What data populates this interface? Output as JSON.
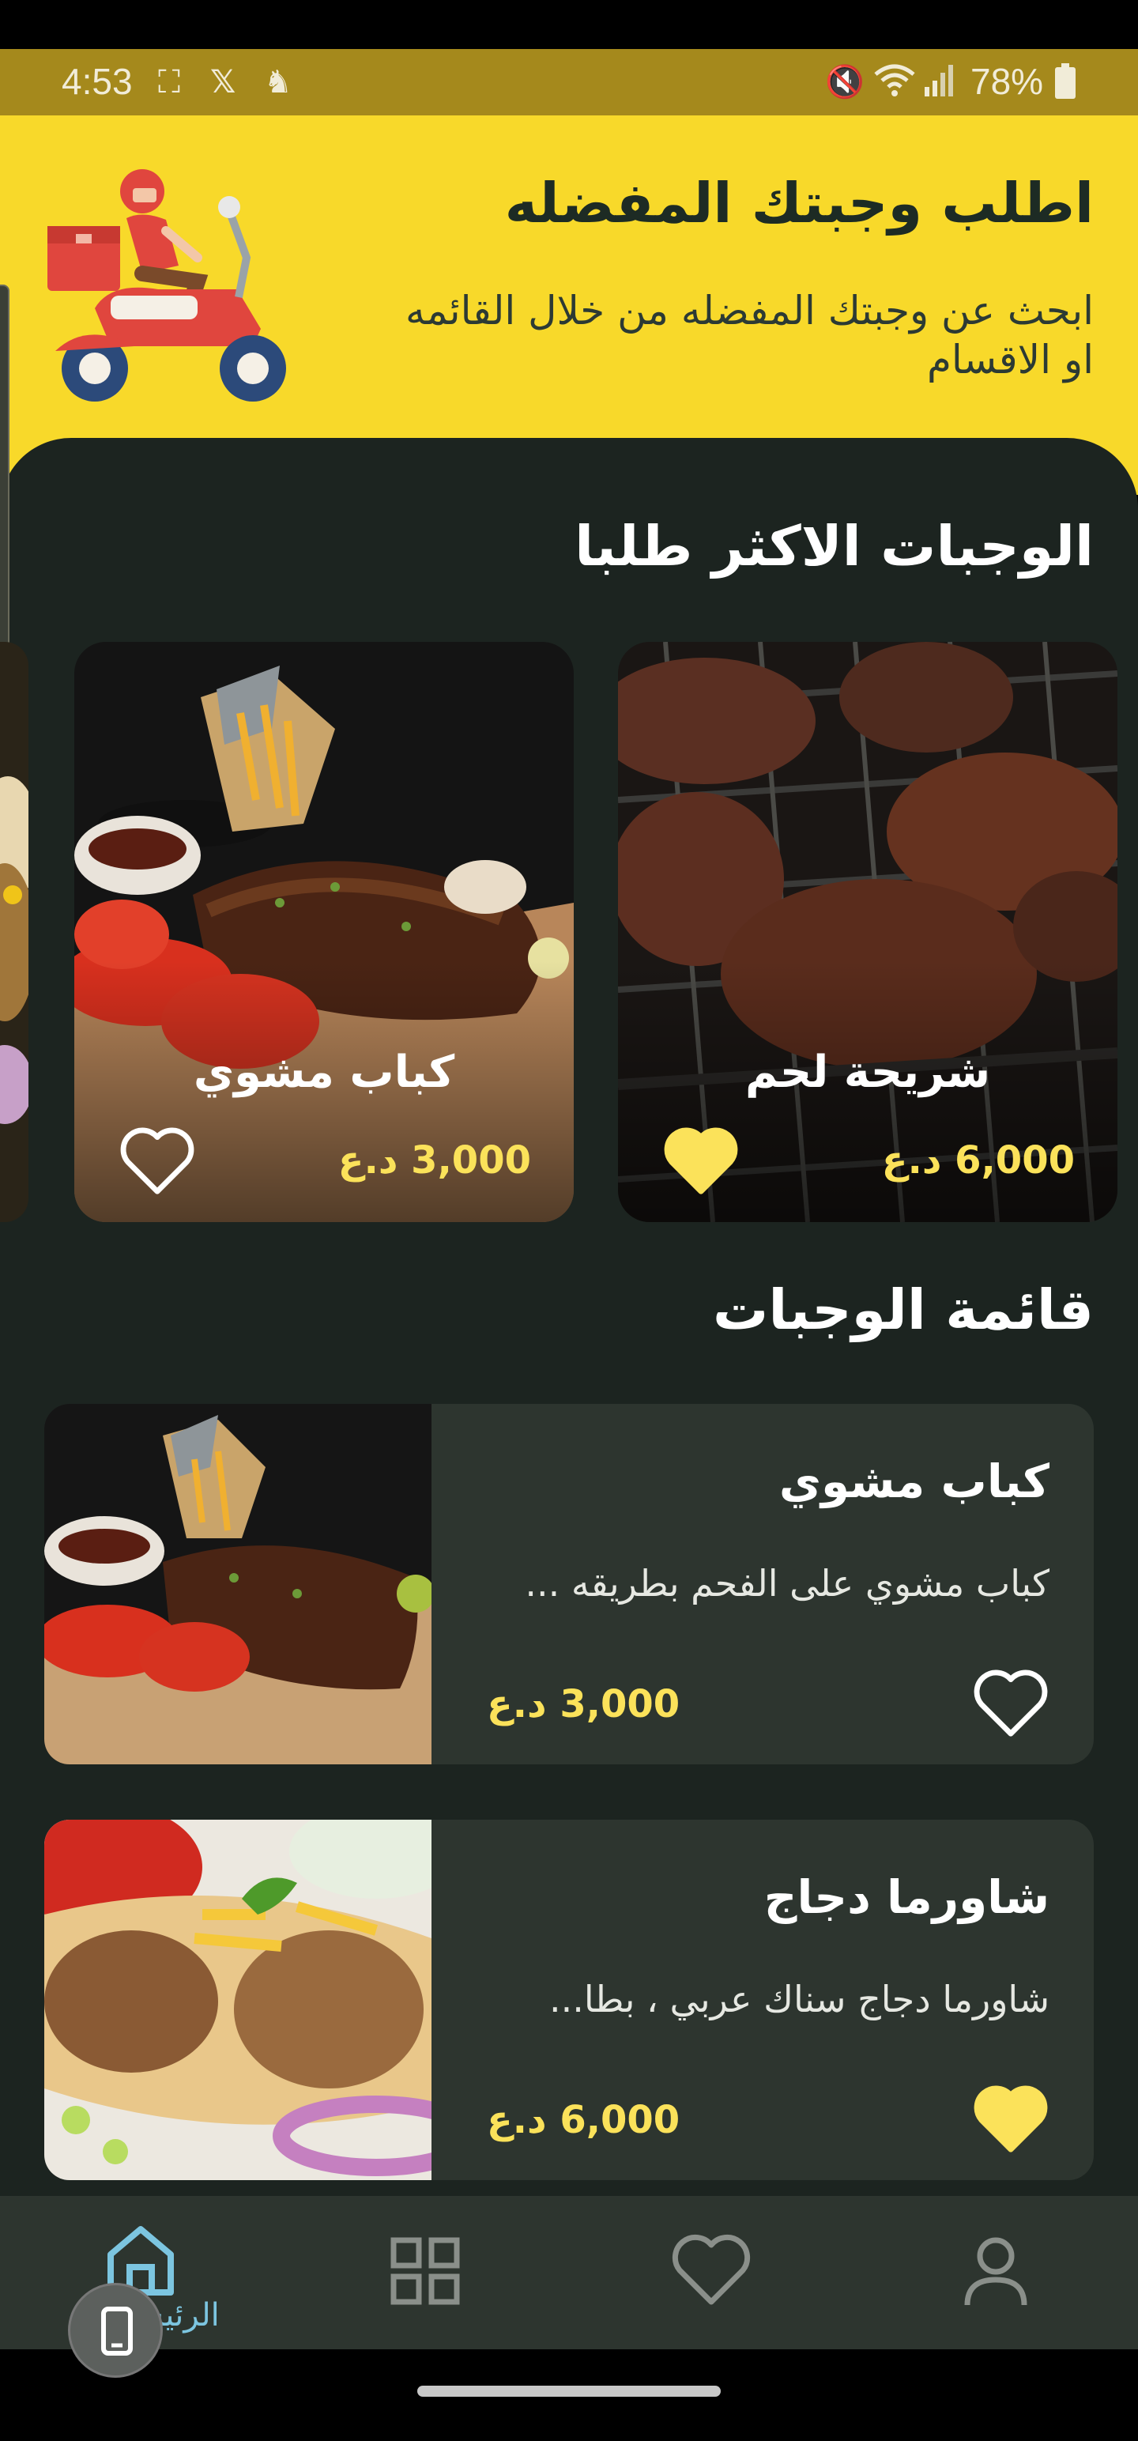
{
  "status_bar": {
    "time": "4:53",
    "battery": "78%",
    "icons": [
      "screenshot-icon",
      "x-icon",
      "app-icon",
      "mute-icon",
      "wifi-icon",
      "signal-icon",
      "battery-icon"
    ]
  },
  "header": {
    "title": "اطلب وجبتك المفضله",
    "subtitle": "ابحث عن وجبتك المفضله من خلال القائمه او الاقسام",
    "illustration": "delivery-scooter"
  },
  "popular": {
    "title": "الوجبات الاكثر طلبا",
    "items": [
      {
        "name": "شريحة لحم",
        "price": "6,000 د.ع",
        "favorite": true
      },
      {
        "name": "كباب مشوي",
        "price": "3,000 د.ع",
        "favorite": false
      }
    ]
  },
  "menu": {
    "title": "قائمة الوجبات",
    "items": [
      {
        "name": "كباب مشوي",
        "description": "كباب مشوي على الفحم بطريقه ...",
        "price": "3,000 د.ع",
        "favorite": false
      },
      {
        "name": "شاورما دجاج",
        "description": "شاورما دجاج سناك عربي ، بطا...",
        "price": "6,000 د.ع",
        "favorite": true
      }
    ]
  },
  "bottom_nav": {
    "items": [
      {
        "label": "الرئيسية",
        "icon": "home-icon",
        "active": true
      },
      {
        "icon": "grid-icon"
      },
      {
        "icon": "heart-icon"
      },
      {
        "icon": "profile-icon"
      }
    ]
  },
  "colors": {
    "accent_yellow": "#f8d92a",
    "price_yellow": "#fbe25a",
    "background": "#1c2420",
    "card": "#2d352f",
    "active_nav": "#7cc5e0"
  }
}
